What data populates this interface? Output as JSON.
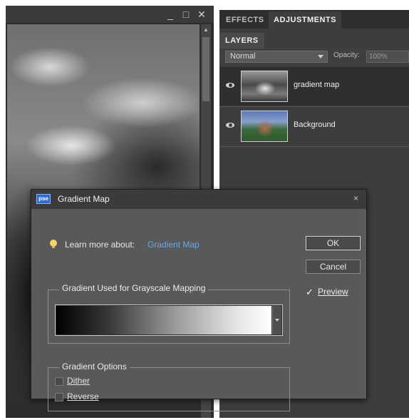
{
  "document_window": {
    "controls": {
      "minimize": "_",
      "maximize": "□",
      "close": "✕"
    },
    "scroll_up": "▲"
  },
  "panel": {
    "tabs": [
      "EFFECTS",
      "ADJUSTMENTS"
    ],
    "active_tab": "ADJUSTMENTS",
    "section_title": "LAYERS",
    "blend_mode": "Normal",
    "opacity_label": "Opacity:",
    "opacity_value": "100%",
    "layers": [
      {
        "name": "gradient map",
        "selected": true
      },
      {
        "name": "Background",
        "selected": false
      }
    ]
  },
  "dialog": {
    "icon_text": "pse",
    "title": "Gradient Map",
    "close": "×",
    "learn_more_label": "Learn more about:",
    "learn_more_link": "Gradient Map",
    "ok_label": "OK",
    "cancel_label": "Cancel",
    "preview_label": "Preview",
    "preview_checked": true,
    "preview_check_glyph": "✓",
    "gradient_group_title": "Gradient Used for Grayscale Mapping",
    "options_group_title": "Gradient Options",
    "dither_label": "Dither",
    "dither_checked": false,
    "reverse_label": "Reverse",
    "reverse_checked": false
  },
  "colors": {
    "link": "#6aa7ea",
    "dialog_bg": "#595959",
    "panel_bg": "#3d3d3d"
  },
  "icons": [
    "window-minimize-icon",
    "window-maximize-icon",
    "window-close-icon",
    "visibility-eye-icon",
    "lightbulb-icon",
    "pse-app-icon",
    "dropdown-arrow-icon",
    "checkmark-icon"
  ]
}
